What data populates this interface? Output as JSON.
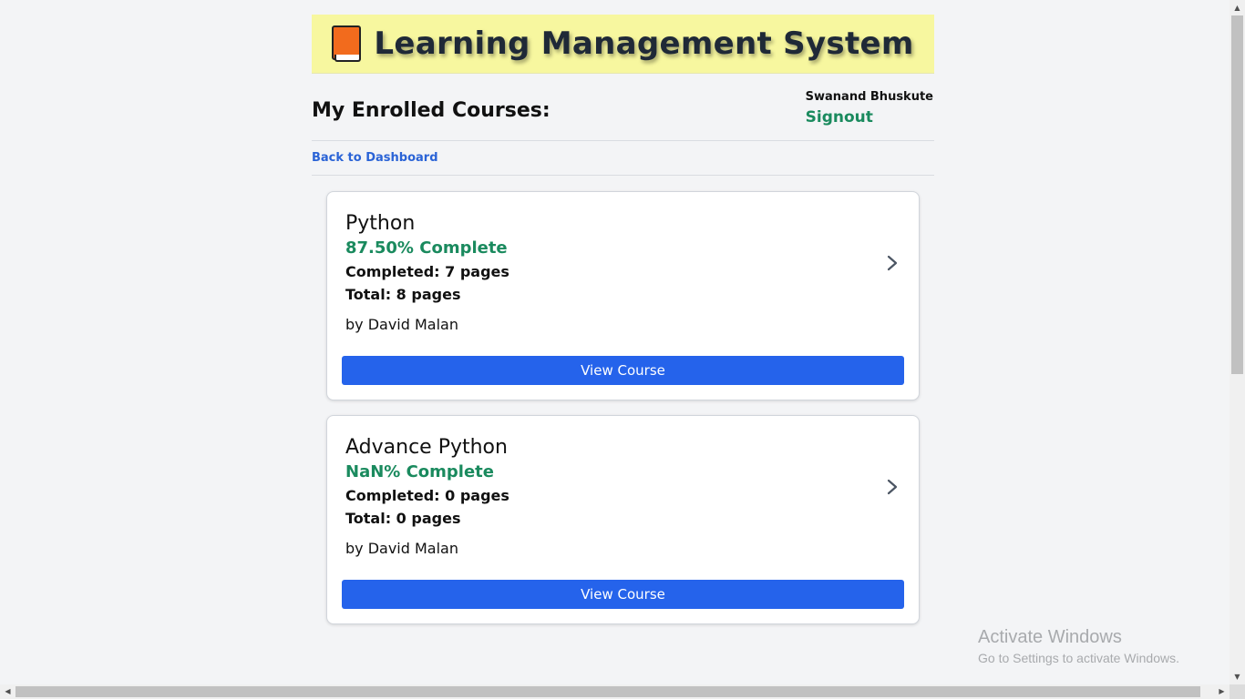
{
  "app": {
    "title": "Learning Management System",
    "logo_icon": "book-icon"
  },
  "header": {
    "page_title": "My Enrolled Courses:",
    "user_name": "Swanand Bhuskute",
    "signout_label": "Signout"
  },
  "nav": {
    "back_label": "Back to Dashboard"
  },
  "courses": [
    {
      "title": "Python",
      "progress": "87.50% Complete",
      "completed": "Completed: 7 pages",
      "total": "Total: 8 pages",
      "author": "by David Malan",
      "button_label": "View Course"
    },
    {
      "title": "Advance Python",
      "progress": "NaN% Complete",
      "completed": "Completed: 0 pages",
      "total": "Total: 0 pages",
      "author": "by David Malan",
      "button_label": "View Course"
    }
  ],
  "watermark": {
    "line1": "Activate Windows",
    "line2": "Go to Settings to activate Windows."
  },
  "colors": {
    "banner": "#f7f79f",
    "accent_green": "#1a8a5e",
    "link_blue": "#2a63d6",
    "button_blue": "#2563eb"
  }
}
